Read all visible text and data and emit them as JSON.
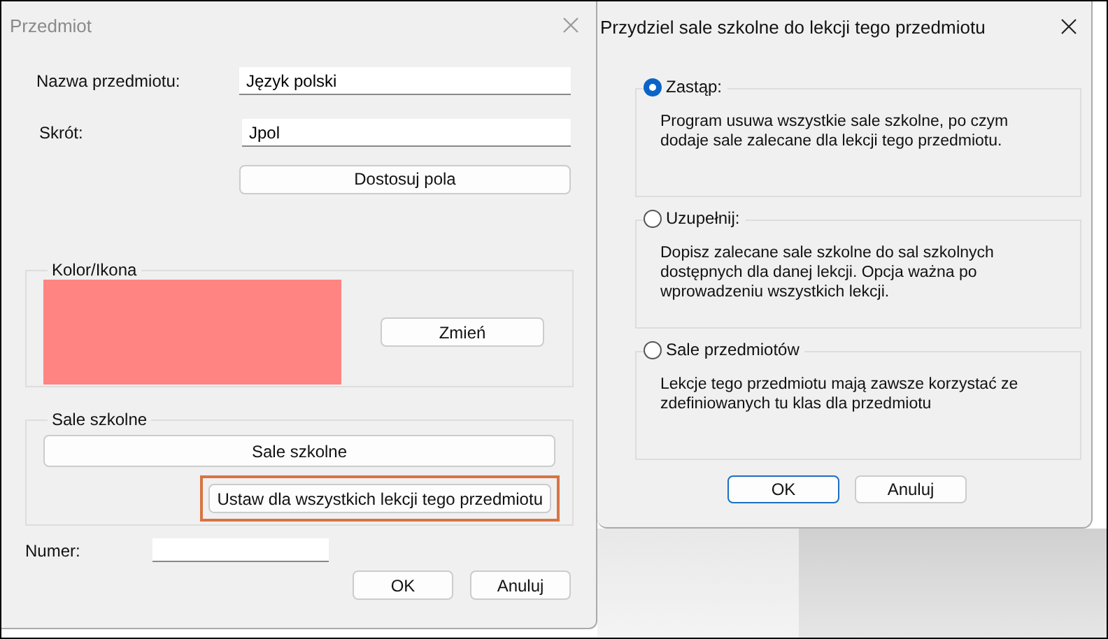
{
  "subject_dialog": {
    "title": "Przedmiot",
    "active": false,
    "fields": [
      {
        "label": "Nazwa przedmiotu:",
        "value": "Język polski"
      },
      {
        "label": "Skrót:",
        "value": "Jpol"
      }
    ],
    "adjust_button": "Dostosuj pola",
    "color_group": {
      "title": "Kolor/Ikona",
      "color": "#ff8482",
      "change_button": "Zmień"
    },
    "rooms_group": {
      "title": "Sale szkolne",
      "rooms_button": "Sale szkolne",
      "set_all_button": {
        "label": "Ustaw dla wszystkich lekcji tego przedmiotu",
        "highlighted": true
      }
    },
    "number": {
      "label": "Numer:"
    },
    "buttons": [
      {
        "label": "OK",
        "default": false
      },
      {
        "label": "Anuluj",
        "default": false
      }
    ]
  },
  "assign_dialog": {
    "title": "Przydziel sale szkolne do lekcji tego przedmiotu",
    "active": true,
    "options": [
      {
        "label": "Zastąp:",
        "selected": true,
        "description": "Program usuwa wszystkie sale szkolne, po czym dodaje sale zalecane dla lekcji tego przedmiotu."
      },
      {
        "label": "Uzupełnij:",
        "selected": false,
        "description": "Dopisz zalecane sale szkolne do sal szkolnych dostępnych dla danej lekcji. Opcja ważna po wprowadzeniu wszystkich lekcji."
      },
      {
        "label": "Sale przedmiotów",
        "selected": false,
        "description": "Lekcje tego przedmiotu mają zawsze korzystać ze zdefiniowanych tu klas dla przedmiotu"
      }
    ],
    "buttons": [
      {
        "label": "OK",
        "default": true
      },
      {
        "label": "Anuluj",
        "default": false
      }
    ]
  }
}
